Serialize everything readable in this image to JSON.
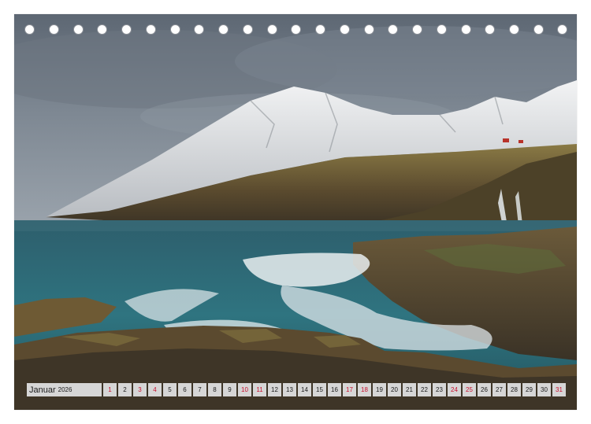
{
  "calendar": {
    "month": "Januar",
    "year": "2026",
    "days": [
      {
        "n": "1",
        "red": true
      },
      {
        "n": "2",
        "red": false
      },
      {
        "n": "3",
        "red": true
      },
      {
        "n": "4",
        "red": true
      },
      {
        "n": "5",
        "red": false
      },
      {
        "n": "6",
        "red": false
      },
      {
        "n": "7",
        "red": false
      },
      {
        "n": "8",
        "red": false
      },
      {
        "n": "9",
        "red": false
      },
      {
        "n": "10",
        "red": true
      },
      {
        "n": "11",
        "red": true
      },
      {
        "n": "12",
        "red": false
      },
      {
        "n": "13",
        "red": false
      },
      {
        "n": "14",
        "red": false
      },
      {
        "n": "15",
        "red": false
      },
      {
        "n": "16",
        "red": false
      },
      {
        "n": "17",
        "red": true
      },
      {
        "n": "18",
        "red": true
      },
      {
        "n": "19",
        "red": false
      },
      {
        "n": "20",
        "red": false
      },
      {
        "n": "21",
        "red": false
      },
      {
        "n": "22",
        "red": false
      },
      {
        "n": "23",
        "red": false
      },
      {
        "n": "24",
        "red": true
      },
      {
        "n": "25",
        "red": true
      },
      {
        "n": "26",
        "red": false
      },
      {
        "n": "27",
        "red": false
      },
      {
        "n": "28",
        "red": false
      },
      {
        "n": "29",
        "red": false
      },
      {
        "n": "30",
        "red": false
      },
      {
        "n": "31",
        "red": true
      }
    ]
  },
  "colors": {
    "weekend": "#c8102e",
    "cell_bg": "#d6d6d6",
    "sky": "#4f5a66",
    "sea": "#2e6f7a"
  }
}
